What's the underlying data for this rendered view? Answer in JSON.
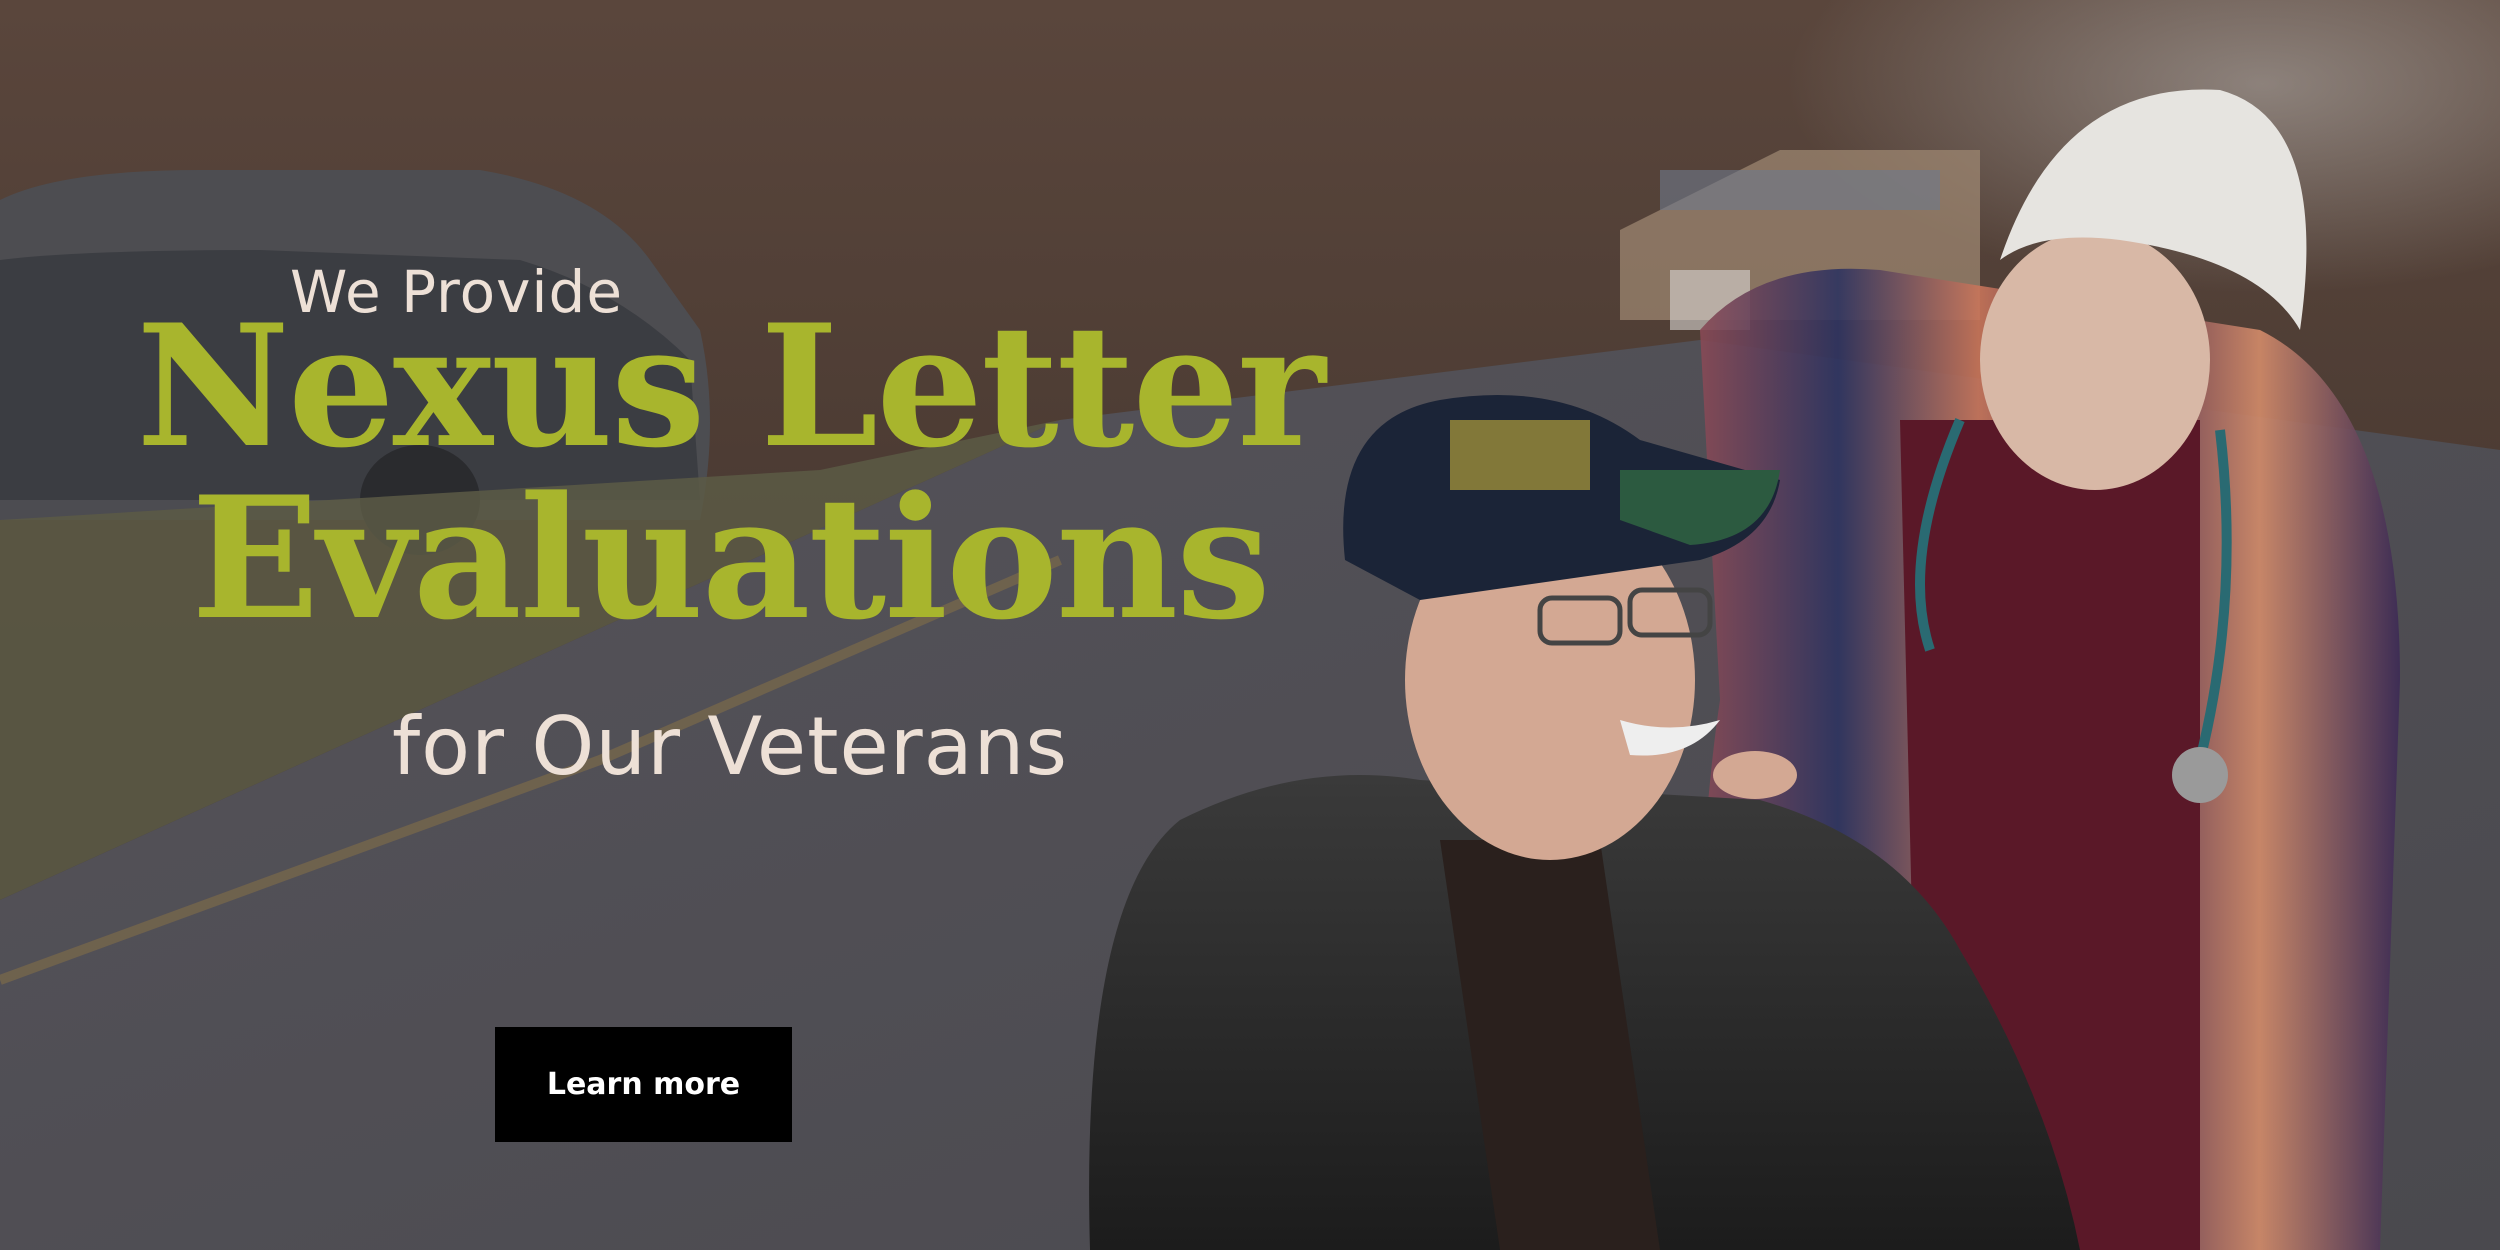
{
  "hero": {
    "pre_title": "We Provide",
    "title_line1": "Nexus Letter",
    "title_line2": "Evaluations",
    "post_title": "for Our Veterans",
    "cta_label": "Learn more",
    "colors": {
      "title": "#a8b52d",
      "subtitle": "#ede0d6",
      "button_bg": "#000000",
      "button_text": "#ffffff"
    },
    "photo_description_icon": "photo-veteran-and-caregiver"
  }
}
